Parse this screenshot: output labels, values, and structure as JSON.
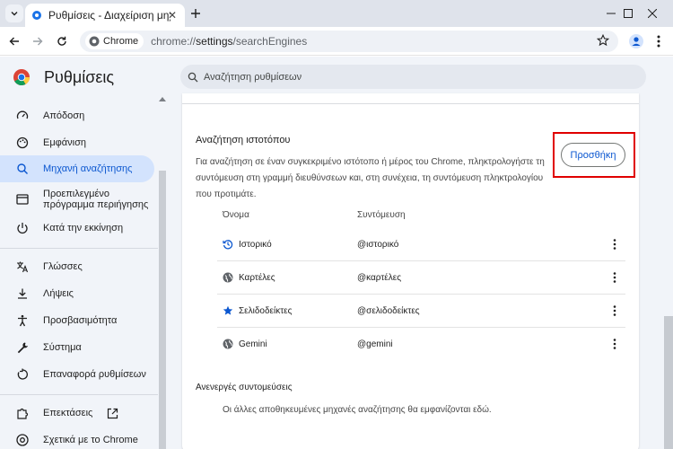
{
  "browser": {
    "tab_title": "Ρυθμίσεις - Διαχείριση μηχανών αναζήτησης",
    "omnibox_chip": "Chrome",
    "url_prefix": "chrome://",
    "url_path": "settings",
    "url_suffix": "/searchEngines"
  },
  "settings": {
    "title": "Ρυθμίσεις",
    "search_placeholder": "Αναζήτηση ρυθμίσεων"
  },
  "sidebar": {
    "items": [
      {
        "label": "Απόδοση",
        "icon": "speedometer-icon"
      },
      {
        "label": "Εμφάνιση",
        "icon": "palette-icon"
      },
      {
        "label": "Μηχανή αναζήτησης",
        "icon": "search-icon",
        "active": true
      },
      {
        "label": "Προεπιλεγμένο πρόγραμμα περιήγησης",
        "icon": "browser-icon"
      },
      {
        "label": "Κατά την εκκίνηση",
        "icon": "power-icon"
      },
      {
        "label": "Γλώσσες",
        "icon": "translate-icon"
      },
      {
        "label": "Λήψεις",
        "icon": "download-icon"
      },
      {
        "label": "Προσβασιμότητα",
        "icon": "accessibility-icon"
      },
      {
        "label": "Σύστημα",
        "icon": "wrench-icon"
      },
      {
        "label": "Επαναφορά ρυθμίσεων",
        "icon": "reset-icon"
      },
      {
        "label": "Επεκτάσεις",
        "icon": "puzzle-icon"
      },
      {
        "label": "Σχετικά με το Chrome",
        "icon": "chrome-icon"
      }
    ]
  },
  "site_search": {
    "title": "Αναζήτηση ιστοτόπου",
    "description": "Για αναζήτηση σε έναν συγκεκριμένο ιστότοπο ή μέρος του Chrome, πληκτρολογήστε τη συντόμευση στη γραμμή διευθύνσεων και, στη συνέχεια, τη συντόμευση πληκτρολογίου που προτιμάτε.",
    "add_button": "Προσθήκη",
    "col_name": "Όνομα",
    "col_shortcut": "Συντόμευση",
    "rows": [
      {
        "name": "Ιστορικό",
        "shortcut": "@ιστορικό",
        "icon": "history-icon"
      },
      {
        "name": "Καρτέλες",
        "shortcut": "@καρτέλες",
        "icon": "globe-icon"
      },
      {
        "name": "Σελιδοδείκτες",
        "shortcut": "@σελιδοδείκτες",
        "icon": "star-icon"
      },
      {
        "name": "Gemini",
        "shortcut": "@gemini",
        "icon": "globe-icon"
      }
    ]
  },
  "inactive": {
    "title": "Ανενεργές συντομεύσεις",
    "description": "Οι άλλες αποθηκευμένες μηχανές αναζήτησης θα εμφανίζονται εδώ."
  },
  "colors": {
    "accent": "#0b57d0",
    "active_bg": "#d3e3fd",
    "highlight": "#e00000"
  }
}
